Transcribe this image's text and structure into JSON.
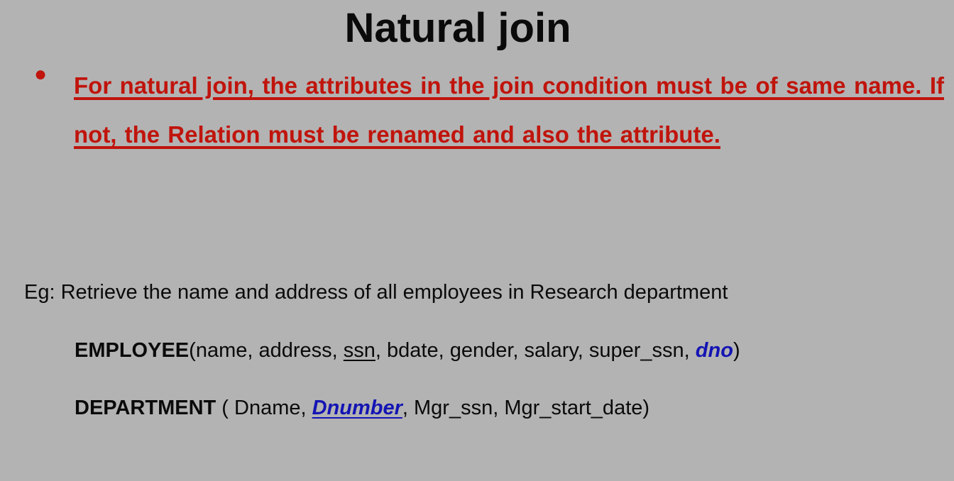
{
  "title": "Natural join",
  "bullet": "For natural join, the attributes in the join condition must be of same name. If not, the Relation must be renamed and also the attribute.",
  "example": "Eg: Retrieve the name and address of all employees in Research department",
  "employee": {
    "relation": "EMPLOYEE",
    "open": "(",
    "before_key": "name, address, ",
    "key": "ssn",
    "middle": ", bdate, gender, salary, super_ssn, ",
    "fk": "dno",
    "close": ")"
  },
  "department": {
    "relation": "DEPARTMENT",
    "open": " ( Dname, ",
    "key": "Dnumber",
    "rest": ", Mgr_ssn, Mgr_start_date)"
  },
  "colors": {
    "background": "#b3b3b3",
    "emphasis_red": "#c0140c",
    "key_blue": "#1414b4"
  }
}
